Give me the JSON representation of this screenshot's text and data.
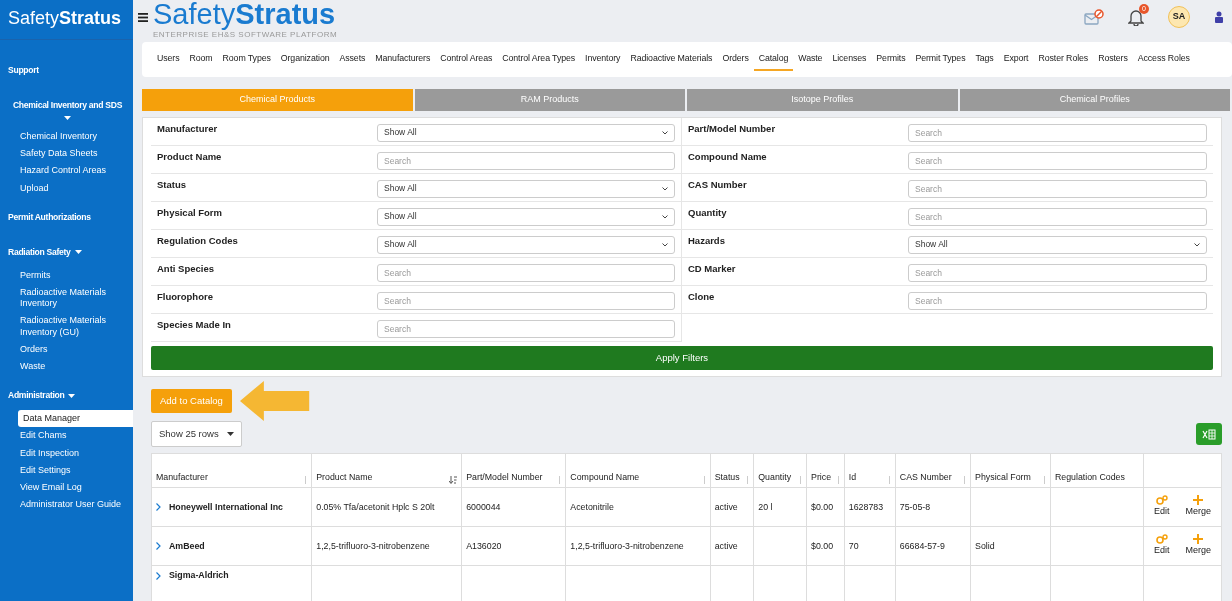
{
  "sidebar": {
    "logo": {
      "light": "Safety",
      "bold": "Stratus"
    },
    "sections": [
      {
        "label": "Support",
        "expanded": false
      },
      {
        "label": "Chemical Inventory and SDS",
        "expanded": true,
        "items": [
          {
            "label": "Chemical Inventory",
            "selected": false
          },
          {
            "label": "Safety Data Sheets",
            "selected": false
          },
          {
            "label": "Hazard Control Areas",
            "selected": false
          },
          {
            "label": "Upload",
            "selected": false
          }
        ]
      },
      {
        "label": "Permit Authorizations",
        "expanded": false
      },
      {
        "label": "Radiation Safety",
        "expanded": true,
        "items": [
          {
            "label": "Permits",
            "selected": false
          },
          {
            "label": "Radioactive Materials Inventory",
            "selected": false
          },
          {
            "label": "Radioactive Materials Inventory (GU)",
            "selected": false
          },
          {
            "label": "Orders",
            "selected": false
          },
          {
            "label": "Waste",
            "selected": false
          }
        ]
      },
      {
        "label": "Administration",
        "expanded": true,
        "items": [
          {
            "label": "Data Manager",
            "selected": true
          },
          {
            "label": "Edit Chams",
            "selected": false
          },
          {
            "label": "Edit Inspection",
            "selected": false
          },
          {
            "label": "Edit Settings",
            "selected": false
          },
          {
            "label": "View Email Log",
            "selected": false
          },
          {
            "label": "Administrator User Guide",
            "selected": false
          }
        ]
      }
    ]
  },
  "header": {
    "logo": {
      "light": "Safety",
      "bold": "Stratus"
    },
    "tagline": "ENTERPRISE EH&S SOFTWARE PLATFORM",
    "notification_count": "0",
    "avatar": "SA"
  },
  "nav": [
    {
      "label": "Users",
      "selected": false
    },
    {
      "label": "Room",
      "selected": false
    },
    {
      "label": "Room Types",
      "selected": false
    },
    {
      "label": "Organization",
      "selected": false
    },
    {
      "label": "Assets",
      "selected": false
    },
    {
      "label": "Manufacturers",
      "selected": false
    },
    {
      "label": "Control Areas",
      "selected": false
    },
    {
      "label": "Control Area Types",
      "selected": false
    },
    {
      "label": "Inventory",
      "selected": false
    },
    {
      "label": "Radioactive Materials",
      "selected": false
    },
    {
      "label": "Orders",
      "selected": false
    },
    {
      "label": "Catalog",
      "selected": true
    },
    {
      "label": "Waste",
      "selected": false
    },
    {
      "label": "Licenses",
      "selected": false
    },
    {
      "label": "Permits",
      "selected": false
    },
    {
      "label": "Permit Types",
      "selected": false
    },
    {
      "label": "Tags",
      "selected": false
    },
    {
      "label": "Export",
      "selected": false
    },
    {
      "label": "Roster Roles",
      "selected": false
    },
    {
      "label": "Rosters",
      "selected": false
    },
    {
      "label": "Access Roles",
      "selected": false
    }
  ],
  "tabs": [
    {
      "label": "Chemical Products",
      "selected": true
    },
    {
      "label": "RAM Products",
      "selected": false
    },
    {
      "label": "Isotope Profiles",
      "selected": false
    },
    {
      "label": "Chemical Profiles",
      "selected": false
    }
  ],
  "filters": {
    "left": [
      {
        "label": "Manufacturer",
        "kind": "select",
        "value": "Show All"
      },
      {
        "label": "Product Name",
        "kind": "text",
        "placeholder": "Search"
      },
      {
        "label": "Status",
        "kind": "select",
        "value": "Show All"
      },
      {
        "label": "Physical Form",
        "kind": "select",
        "value": "Show All"
      },
      {
        "label": "Regulation Codes",
        "kind": "select",
        "value": "Show All"
      },
      {
        "label": "Anti Species",
        "kind": "text",
        "placeholder": "Search"
      },
      {
        "label": "Fluorophore",
        "kind": "text",
        "placeholder": "Search"
      },
      {
        "label": "Species Made In",
        "kind": "text",
        "placeholder": "Search"
      }
    ],
    "right": [
      {
        "label": "Part/Model Number",
        "kind": "text",
        "placeholder": "Search"
      },
      {
        "label": "Compound Name",
        "kind": "text",
        "placeholder": "Search"
      },
      {
        "label": "CAS Number",
        "kind": "text",
        "placeholder": "Search"
      },
      {
        "label": "Quantity",
        "kind": "text",
        "placeholder": "Search"
      },
      {
        "label": "Hazards",
        "kind": "select",
        "value": "Show All"
      },
      {
        "label": "CD Marker",
        "kind": "text",
        "placeholder": "Search"
      },
      {
        "label": "Clone",
        "kind": "text",
        "placeholder": "Search"
      }
    ],
    "apply": "Apply Filters"
  },
  "add_button": "Add to Catalog",
  "rows_select": "Show 25 rows",
  "table": {
    "columns": [
      {
        "label": "Manufacturer",
        "sortable": true,
        "sorted": false
      },
      {
        "label": "Product Name",
        "sortable": true,
        "sorted": true
      },
      {
        "label": "Part/Model Number",
        "sortable": true,
        "sorted": false
      },
      {
        "label": "Compound Name",
        "sortable": true,
        "sorted": false
      },
      {
        "label": "Status",
        "sortable": true,
        "sorted": false
      },
      {
        "label": "Quantity",
        "sortable": true,
        "sorted": false
      },
      {
        "label": "Price",
        "sortable": true,
        "sorted": false
      },
      {
        "label": "Id",
        "sortable": true,
        "sorted": false
      },
      {
        "label": "CAS Number",
        "sortable": true,
        "sorted": false
      },
      {
        "label": "Physical Form",
        "sortable": true,
        "sorted": false
      },
      {
        "label": "Regulation Codes",
        "sortable": false
      }
    ],
    "rows": [
      {
        "cells": [
          "Honeywell International Inc",
          "0.05% Tfa/acetonit Hplc S 20lt",
          "6000044",
          "Acetonitrile",
          "active",
          "20 l",
          "$0.00",
          "1628783",
          "75-05-8",
          "",
          ""
        ],
        "actions": [
          "Edit",
          "Merge"
        ]
      },
      {
        "cells": [
          "AmBeed",
          "1,2,5-trifluoro-3-nitrobenzene",
          "A136020",
          "1,2,5-trifluoro-3-nitrobenzene",
          "active",
          "",
          "$0.00",
          "70",
          "66684-57-9",
          "Solid",
          ""
        ],
        "actions": [
          "Edit",
          "Merge"
        ]
      },
      {
        "cells": [
          "Sigma-Aldrich",
          "",
          "",
          "",
          "",
          "",
          "",
          "",
          "",
          "",
          ""
        ],
        "actions": []
      }
    ]
  }
}
